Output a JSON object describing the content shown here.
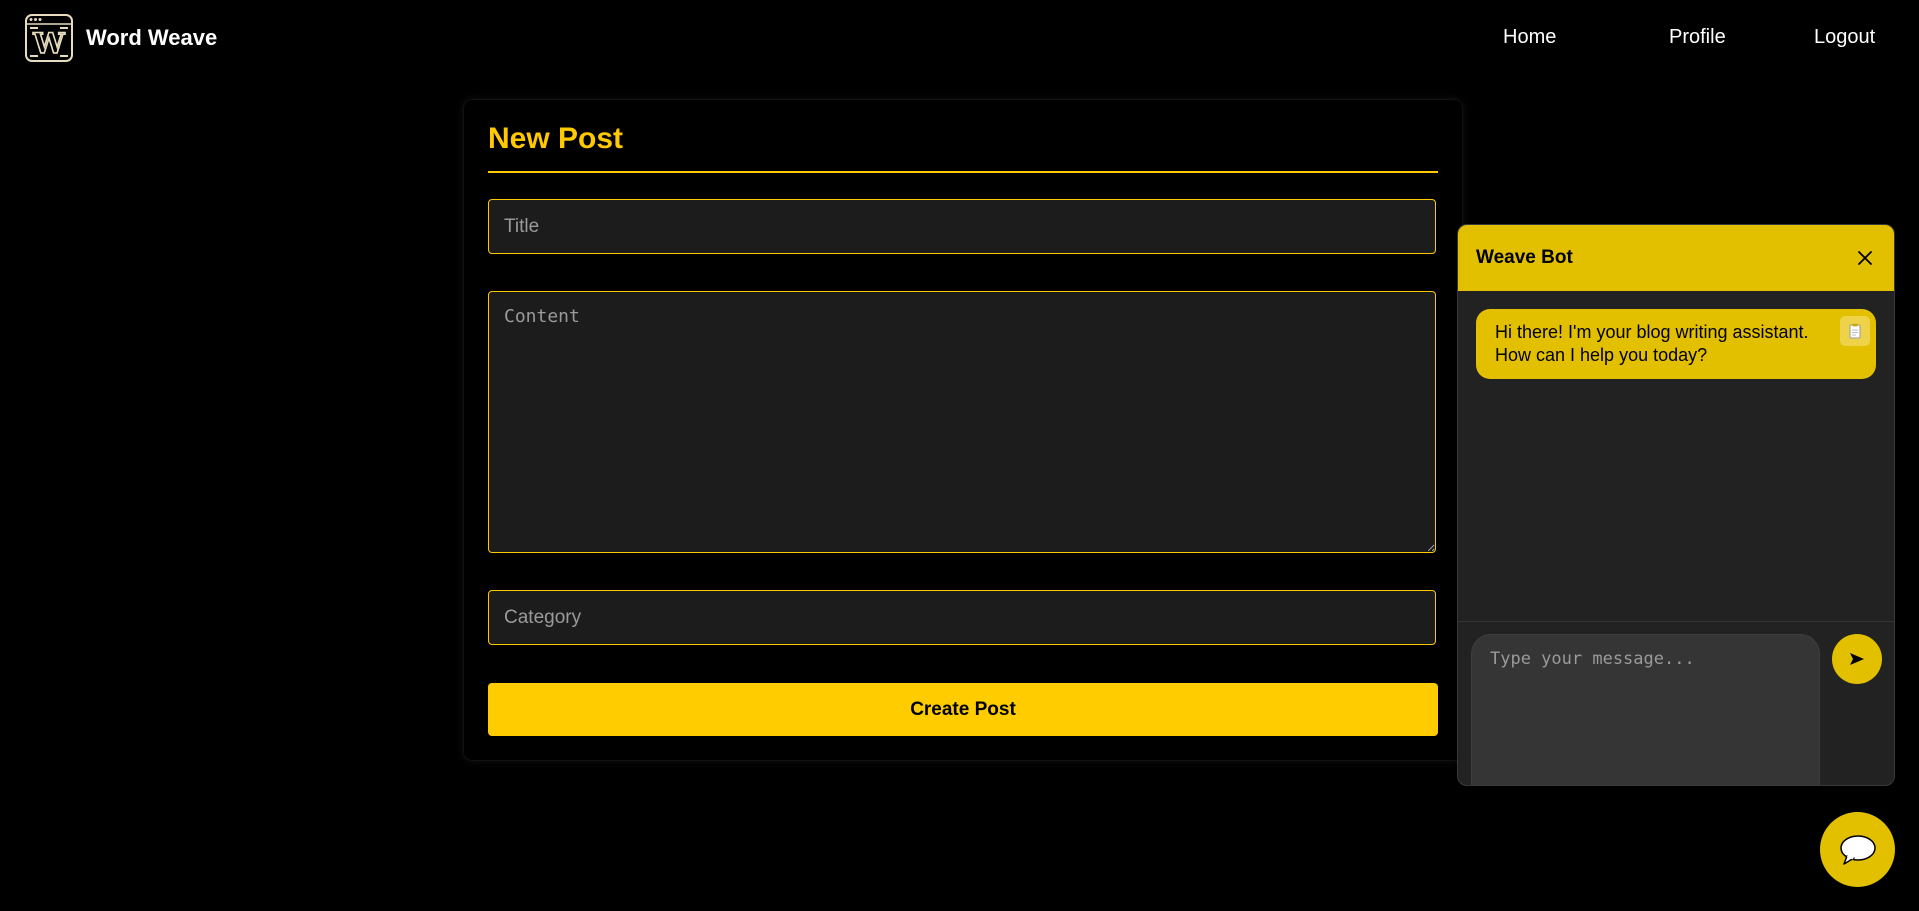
{
  "header": {
    "brand_name": "Word Weave",
    "logo_letter": "W",
    "nav": {
      "home": "Home",
      "profile": "Profile",
      "logout": "Logout"
    }
  },
  "form": {
    "heading": "New Post",
    "title_placeholder": "Title",
    "title_value": "",
    "content_placeholder": "Content",
    "content_value": "",
    "category_placeholder": "Category",
    "category_value": "",
    "submit_label": "Create Post"
  },
  "chat": {
    "title": "Weave Bot",
    "messages": [
      {
        "sender": "bot",
        "text": "Hi there! I'm your blog writing assistant. How can I help you today?"
      }
    ],
    "input_placeholder": "Type your message...",
    "input_value": "",
    "send_icon": "send-icon",
    "close_icon": "close-icon",
    "copy_icon": "copy-icon"
  },
  "fab": {
    "icon": "chat-bubble-icon"
  },
  "colors": {
    "accent": "#ffc800",
    "chat_accent": "#e2c000",
    "background": "#000000",
    "field_background": "#1c1c1c"
  }
}
